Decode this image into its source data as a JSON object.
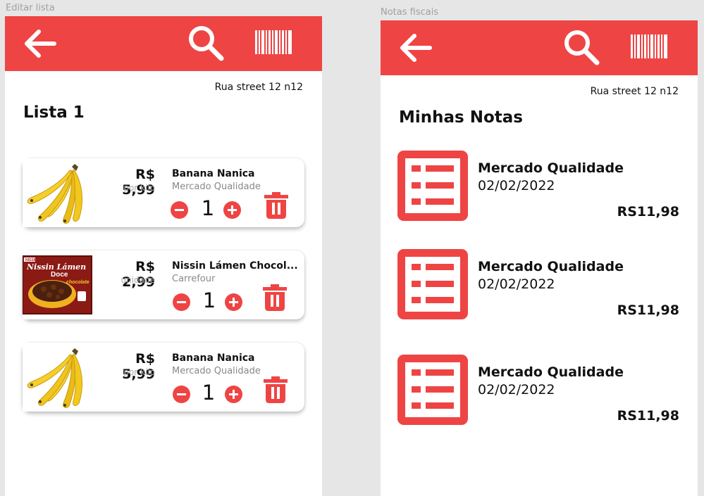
{
  "frames": {
    "left_label": "Editar lista",
    "right_label": "Notas fiscais"
  },
  "colors": {
    "accent": "#ef4444",
    "text": "#111111",
    "muted": "#888888"
  },
  "icons": {
    "back": "arrow-left-icon",
    "search": "search-icon",
    "barcode": "barcode-icon",
    "minus": "minus-circle-icon",
    "plus": "plus-circle-icon",
    "trash": "trash-icon",
    "receipt": "receipt-list-icon"
  },
  "edit_list": {
    "address": "Rua street 12 n12",
    "title": "Lista 1",
    "items": [
      {
        "price": "R$ 5,99",
        "unit": "por kilo",
        "name": "Banana Nanica",
        "store": "Mercado Qualidade",
        "qty": "1",
        "image": "banana"
      },
      {
        "price": "R$ 2,99",
        "unit": "unidade",
        "name": "Nissin Lámen Chocol...",
        "store": "Carrefour",
        "qty": "1",
        "image": "nissin"
      },
      {
        "price": "R$ 5,99",
        "unit": "por kilo",
        "name": "Banana Nanica",
        "store": "Mercado Qualidade",
        "qty": "1",
        "image": "banana"
      }
    ]
  },
  "notas": {
    "address": "Rua street 12 n12",
    "title": "Minhas Notas",
    "items": [
      {
        "store": "Mercado Qualidade",
        "date": "02/02/2022",
        "total": "RS11,98"
      },
      {
        "store": "Mercado Qualidade",
        "date": "02/02/2022",
        "total": "RS11,98"
      },
      {
        "store": "Mercado Qualidade",
        "date": "02/02/2022",
        "total": "RS11,98"
      }
    ]
  },
  "product_image_text": {
    "brand": "NISSIN",
    "line1": "Nissin Lámen",
    "line2": "Doce",
    "flavor": "chocolate"
  }
}
